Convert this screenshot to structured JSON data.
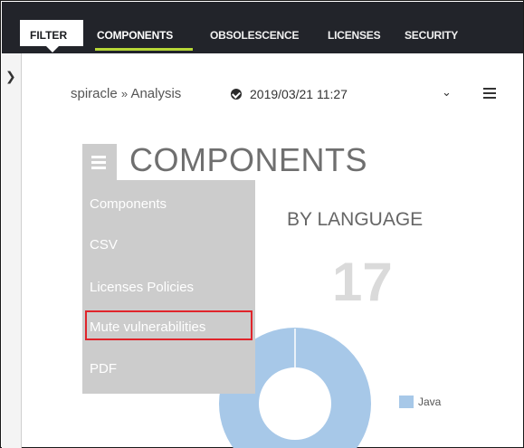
{
  "nav": {
    "tabs": [
      {
        "label": "FILTER"
      },
      {
        "label": "COMPONENTS"
      },
      {
        "label": "OBSOLESCENCE"
      },
      {
        "label": "LICENSES"
      },
      {
        "label": "SECURITY"
      }
    ],
    "active_tab": "COMPONENTS",
    "accent_color": "#b6d637"
  },
  "sidebar": {
    "toggle_icon": "chevron-right-icon"
  },
  "breadcrumb": {
    "project": "spiracle",
    "separator": "»",
    "page": "Analysis"
  },
  "analysis_select": {
    "value": "2019/03/21 11:27",
    "icon": "check-circle-icon",
    "caret_icon": "chevron-down-icon"
  },
  "options_menu_icon": "hamburger-menu-icon",
  "section": {
    "title": "COMPONENTS",
    "menu_icon": "hamburger-menu-icon"
  },
  "export_menu": {
    "items": [
      {
        "label": "Components"
      },
      {
        "label": "CSV"
      },
      {
        "label": "Licenses Policies"
      },
      {
        "label": "Mute vulnerabilities",
        "highlighted": true
      },
      {
        "label": "PDF"
      }
    ],
    "highlight_color": "#e0252b"
  },
  "by_language": {
    "title": "BY LANGUAGE",
    "count": "17",
    "legend": [
      {
        "label": "Java",
        "color": "#a7c8e8"
      }
    ]
  }
}
